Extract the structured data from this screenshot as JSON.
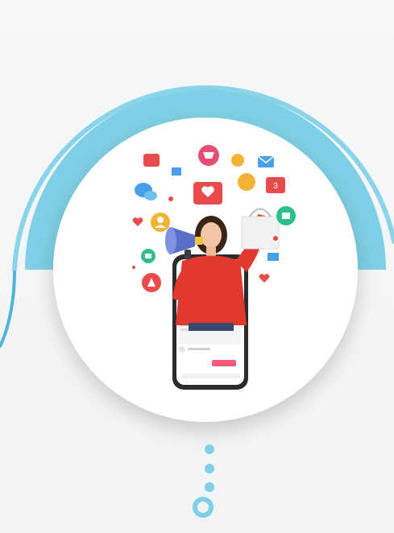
{
  "colors": {
    "background": "#f3f4f6",
    "accent": "#7fd0e6",
    "accent_dark": "#4fb4d8",
    "icon_red": "#e84b4b",
    "icon_green": "#2fbf8f",
    "icon_blue": "#4aa0e6",
    "icon_yellow": "#f2b234",
    "icon_pink": "#e64d74",
    "shirt": "#e2382f"
  },
  "illustration": {
    "subject": "person-with-megaphone-and-shopping-bag",
    "icons": [
      {
        "name": "cart-icon"
      },
      {
        "name": "heart-icon"
      },
      {
        "name": "like-icon"
      },
      {
        "name": "user-icon"
      },
      {
        "name": "mail-icon"
      },
      {
        "name": "chat-icon"
      },
      {
        "name": "play-icon"
      },
      {
        "name": "megaphone-icon"
      }
    ]
  },
  "phone_mock": {
    "screen_text": ""
  }
}
